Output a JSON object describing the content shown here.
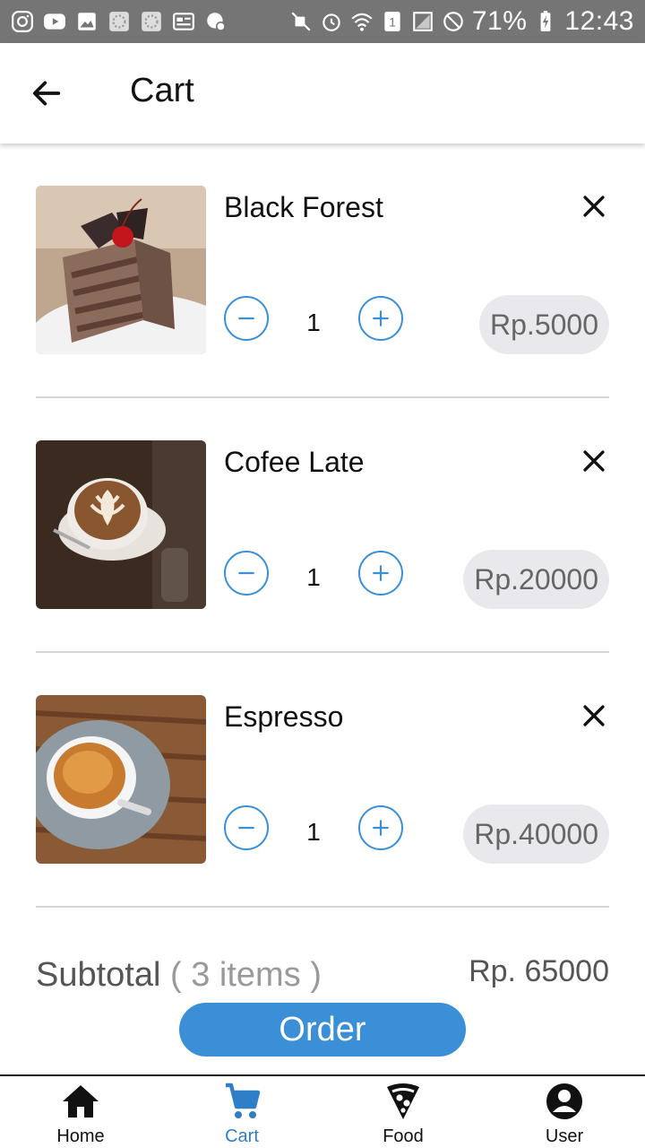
{
  "status_bar": {
    "battery": "71%",
    "time": "12:43",
    "icons": [
      "instagram-icon",
      "youtube-icon",
      "gallery-icon",
      "pattern-icon",
      "pattern-icon",
      "news-icon",
      "vpn-icon",
      "mute-icon",
      "alarm-icon",
      "wifi-icon",
      "sim-icon",
      "signal-icon",
      "do-not-disturb-icon",
      "battery-charging-icon"
    ]
  },
  "header": {
    "title": "Cart",
    "back_icon": "arrow-back-icon"
  },
  "cart": {
    "items": [
      {
        "name": "Black Forest",
        "quantity": "1",
        "price": "Rp.5000",
        "image": "black-forest-cake"
      },
      {
        "name": "Cofee Late",
        "quantity": "1",
        "price": "Rp.20000",
        "image": "latte-art-cup"
      },
      {
        "name": "Espresso",
        "quantity": "1",
        "price": "Rp.40000",
        "image": "espresso-cup"
      }
    ]
  },
  "summary": {
    "subtotal_label": "Subtotal",
    "item_count": "( 3 items )",
    "subtotal_value": "Rp. 65000",
    "order_label": "Order"
  },
  "bottom_nav": {
    "items": [
      {
        "label": "Home",
        "icon": "home-icon",
        "active": false
      },
      {
        "label": "Cart",
        "icon": "cart-icon",
        "active": true
      },
      {
        "label": "Food",
        "icon": "pizza-icon",
        "active": false
      },
      {
        "label": "User",
        "icon": "user-icon",
        "active": false
      }
    ]
  },
  "colors": {
    "accent": "#3a8fd6",
    "active_nav": "#2f7fc8",
    "status_bar": "#757575",
    "price_pill": "#e9e9ed"
  }
}
